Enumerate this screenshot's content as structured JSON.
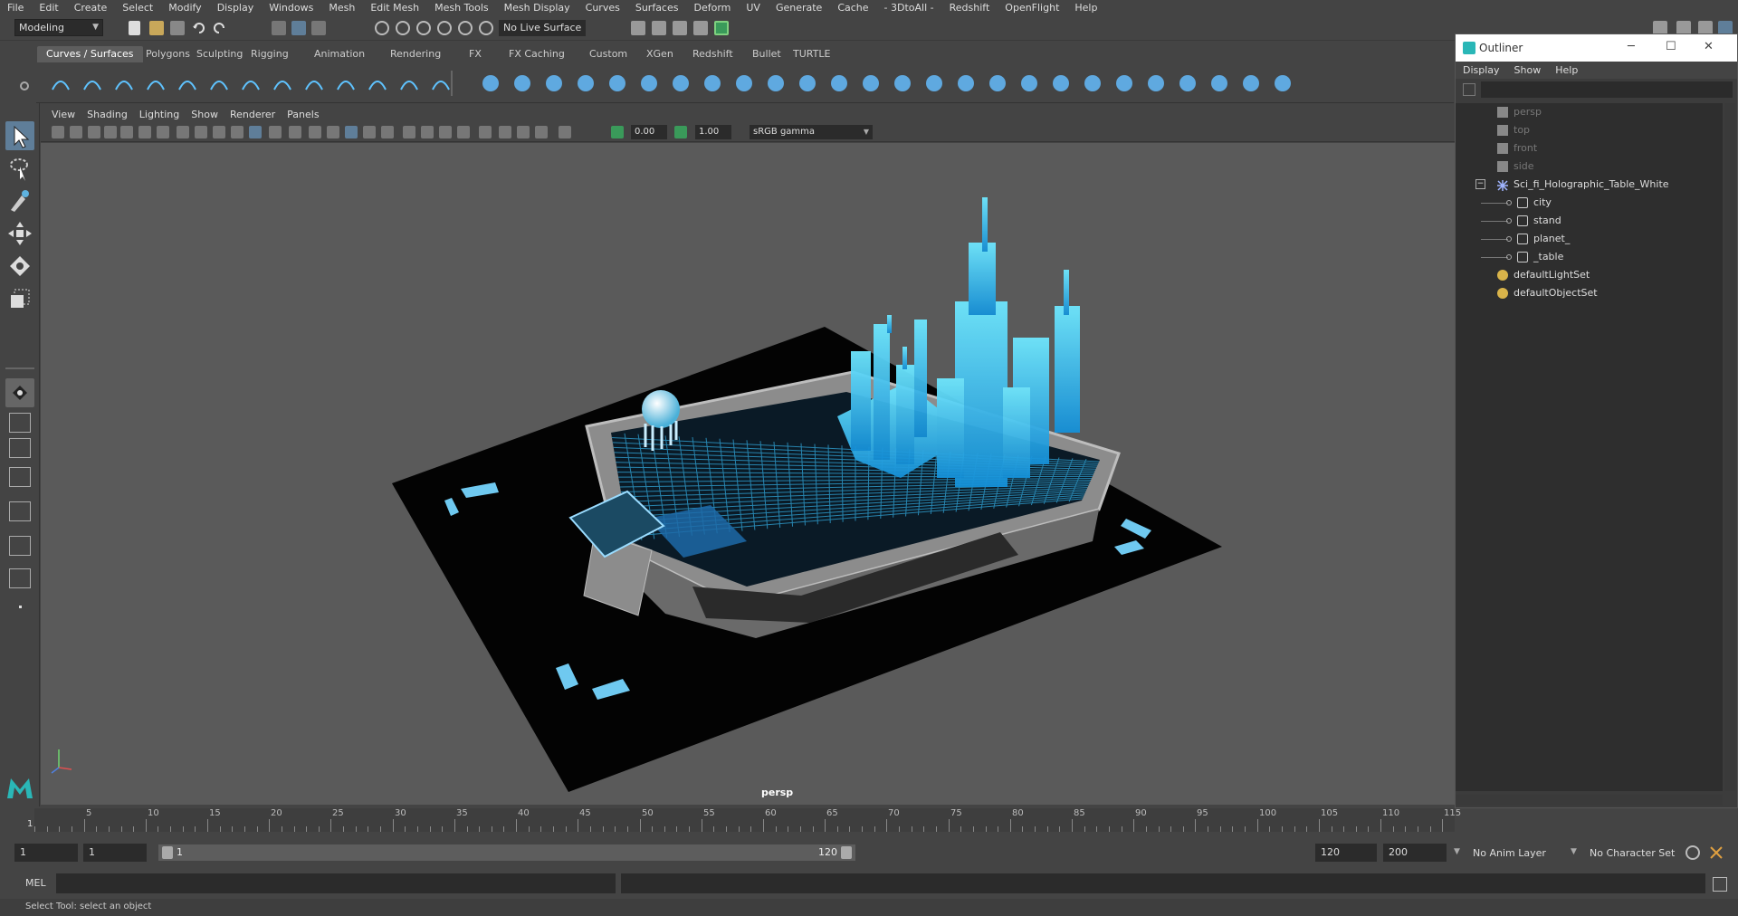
{
  "menubar": {
    "items": [
      "File",
      "Edit",
      "Create",
      "Select",
      "Modify",
      "Display",
      "Windows",
      "Mesh",
      "Edit Mesh",
      "Mesh Tools",
      "Mesh Display",
      "Curves",
      "Surfaces",
      "Deform",
      "UV",
      "Generate",
      "Cache",
      "- 3DtoAll -",
      "Redshift",
      "OpenFlight",
      "Help"
    ]
  },
  "status": {
    "mode": "Modeling",
    "live_surface": "No Live Surface"
  },
  "shelf": {
    "tabs": [
      "Curves / Surfaces",
      "Polygons",
      "Sculpting",
      "Rigging",
      "Animation",
      "Rendering",
      "FX",
      "FX Caching",
      "Custom",
      "XGen",
      "Redshift",
      "Bullet",
      "TURTLE"
    ],
    "active_tab": "Curves / Surfaces"
  },
  "viewport": {
    "menu": [
      "View",
      "Shading",
      "Lighting",
      "Show",
      "Renderer",
      "Panels"
    ],
    "exposure": "0.00",
    "gamma": "1.00",
    "color_space": "sRGB gamma",
    "camera": "persp"
  },
  "outliner": {
    "title": "Outliner",
    "menu": [
      "Display",
      "Show",
      "Help"
    ],
    "items": [
      {
        "label": "persp",
        "type": "camera",
        "dim": true,
        "indent": 0
      },
      {
        "label": "top",
        "type": "camera",
        "dim": true,
        "indent": 0
      },
      {
        "label": "front",
        "type": "camera",
        "dim": true,
        "indent": 0
      },
      {
        "label": "side",
        "type": "camera",
        "dim": true,
        "indent": 0
      },
      {
        "label": "Sci_fi_Holographic_Table_White",
        "type": "group",
        "dim": false,
        "indent": 0
      },
      {
        "label": "city",
        "type": "mesh",
        "dim": false,
        "indent": 1
      },
      {
        "label": "stand",
        "type": "mesh",
        "dim": false,
        "indent": 1
      },
      {
        "label": "planet_",
        "type": "mesh",
        "dim": false,
        "indent": 1
      },
      {
        "label": "_table",
        "type": "mesh",
        "dim": false,
        "indent": 1
      },
      {
        "label": "defaultLightSet",
        "type": "set",
        "dim": false,
        "indent": 0
      },
      {
        "label": "defaultObjectSet",
        "type": "set",
        "dim": false,
        "indent": 0
      }
    ]
  },
  "timeline": {
    "ticks": [
      "5",
      "10",
      "15",
      "20",
      "25",
      "30",
      "35",
      "40",
      "45",
      "50",
      "55",
      "60",
      "65",
      "70",
      "75",
      "80",
      "85",
      "90",
      "95",
      "100",
      "105",
      "110",
      "115"
    ],
    "current_frame": "1"
  },
  "range": {
    "start": "1",
    "playback_start": "1",
    "slider_start": "1",
    "slider_end": "120",
    "playback_end": "120",
    "end": "200",
    "anim_layer": "No Anim Layer",
    "character_set": "No Character Set"
  },
  "command": {
    "language": "MEL",
    "help": "Select Tool: select an object"
  },
  "colors": {
    "accent": "#5f7e99",
    "hologram": "#3fd4ff",
    "viewport_bg": "#5a5a5a"
  }
}
